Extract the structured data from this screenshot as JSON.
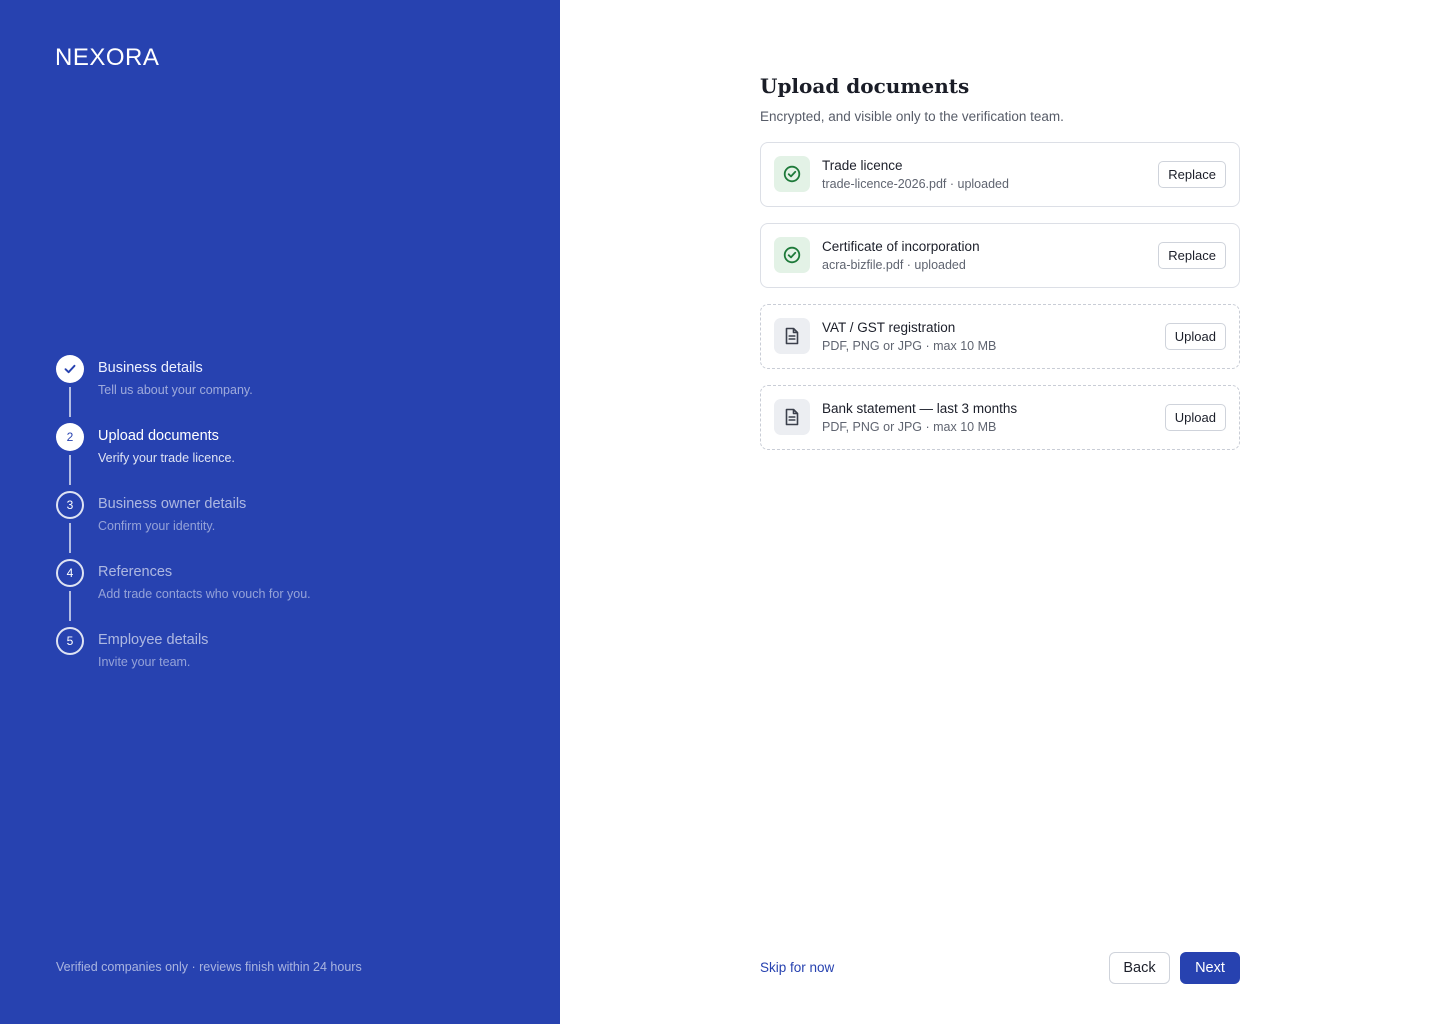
{
  "brand": {
    "logo": "NEXORA"
  },
  "steps": [
    {
      "number": "1",
      "title": "Business details",
      "desc": "Tell us about your company.",
      "state": "done"
    },
    {
      "number": "2",
      "title": "Upload documents",
      "desc": "Verify your trade licence.",
      "state": "active"
    },
    {
      "number": "3",
      "title": "Business owner details",
      "desc": "Confirm your identity.",
      "state": "upcoming"
    },
    {
      "number": "4",
      "title": "References",
      "desc": "Add trade contacts who vouch for you.",
      "state": "upcoming"
    },
    {
      "number": "5",
      "title": "Employee details",
      "desc": "Invite your team.",
      "state": "upcoming"
    }
  ],
  "footnote": "Verified companies only · reviews finish within 24 hours",
  "main": {
    "title": "Upload documents",
    "subtitle": "Encrypted, and visible only to the verification team."
  },
  "documents": [
    {
      "name": "Trade licence",
      "meta": "trade-licence-2026.pdf · uploaded",
      "status": "uploaded",
      "icon": "check-circle-icon",
      "action": "Replace"
    },
    {
      "name": "Certificate of incorporation",
      "meta": "acra-bizfile.pdf · uploaded",
      "status": "uploaded",
      "icon": "check-circle-icon",
      "action": "Replace"
    },
    {
      "name": "VAT / GST registration",
      "meta": "PDF, PNG or JPG · max 10 MB",
      "status": "pending",
      "icon": "document-icon",
      "action": "Upload"
    },
    {
      "name": "Bank statement — last 3 months",
      "meta": "PDF, PNG or JPG · max 10 MB",
      "status": "pending",
      "icon": "document-icon",
      "action": "Upload"
    }
  ],
  "footer": {
    "skip": "Skip for now",
    "back": "Back",
    "next": "Next"
  },
  "colors": {
    "brand": "#2742b0",
    "success": "#1e7a3a",
    "success_bg": "#e3f2e6",
    "neutral_icon": "#3b404c"
  }
}
